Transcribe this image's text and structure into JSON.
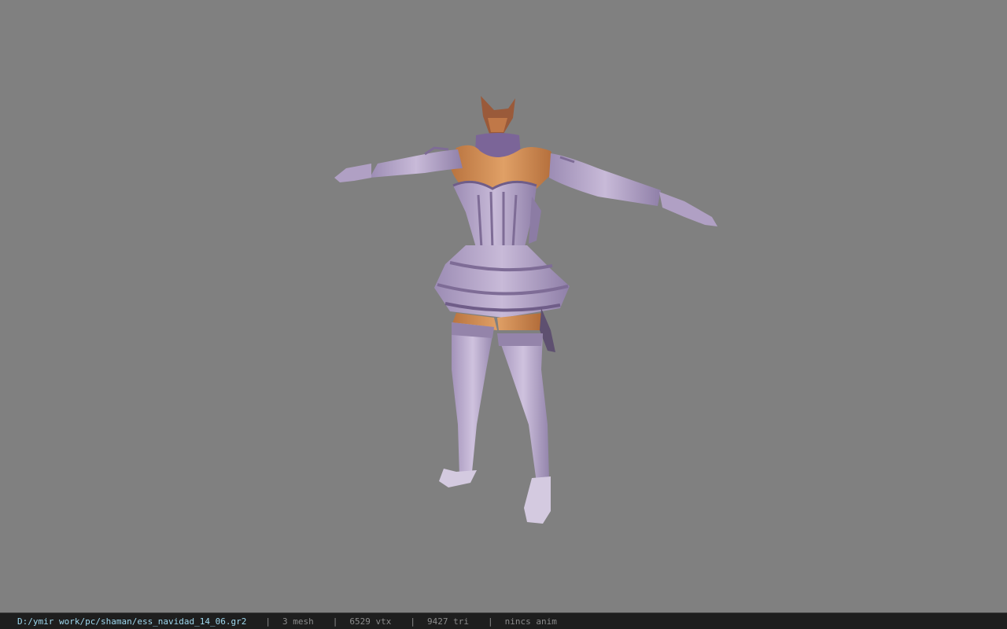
{
  "viewport": {
    "background": "#808080",
    "model_name": "3d-character-model"
  },
  "status_bar": {
    "file_path": "D:/ymir work/pc/shaman/ess_navidad_14_06.gr2",
    "separator": "|",
    "mesh_count": "3 mesh",
    "vertex_count": "6529 vtx",
    "triangle_count": "9427 tri",
    "animation": "nincs anim"
  },
  "colors": {
    "dress": "#b8a8cc",
    "dress_dark": "#7e6c96",
    "skin": "#d08c56",
    "status_bg": "#1e1e1e",
    "path_text": "#9ed8ee"
  }
}
